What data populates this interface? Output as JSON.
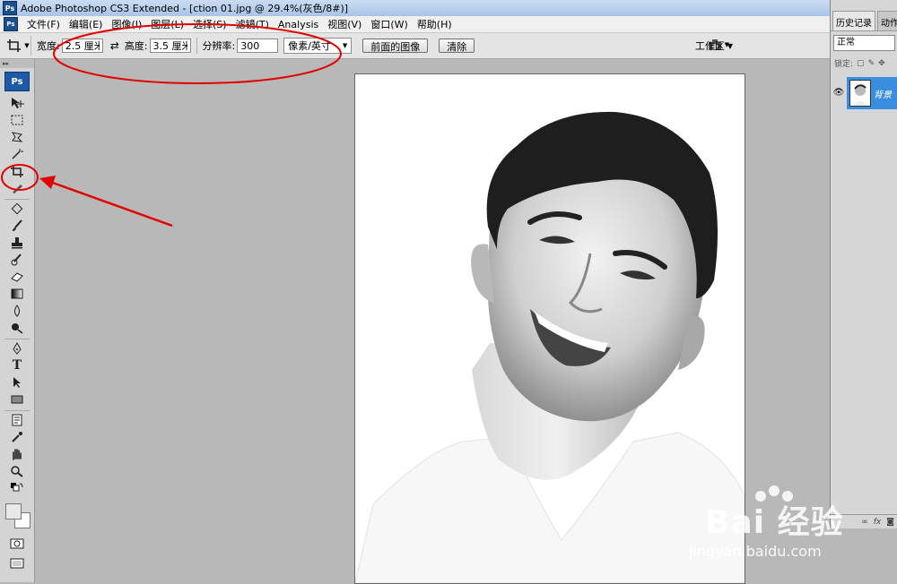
{
  "titlebar": {
    "title": "Adobe Photoshop CS3 Extended - [ction 01.jpg @ 29.4%(灰色/8#)]",
    "logo": "Ps"
  },
  "menubar": {
    "app_icon": "Ps",
    "items": [
      "文件(F)",
      "编辑(E)",
      "图像(I)",
      "图层(L)",
      "选择(S)",
      "滤镜(T)",
      "Analysis",
      "视图(V)",
      "窗口(W)",
      "帮助(H)"
    ]
  },
  "options": {
    "width_label": "宽度:",
    "width_value": "2.5 厘米",
    "height_label": "高度:",
    "height_value": "3.5 厘米",
    "resolution_label": "分辨率:",
    "resolution_value": "300",
    "unit_select": "像素/英寸",
    "front_image_button": "前面的图像",
    "clear_button": "清除",
    "workspace_label": "工作区"
  },
  "toolbox": {
    "logo": "Ps",
    "grip": "▸▸"
  },
  "panels": {
    "tabs": [
      "历史记录",
      "动作"
    ],
    "blend_mode": "正常",
    "lock_label": "锁定:",
    "layer_name": "背景"
  },
  "watermark": {
    "brand": "Bai  经验",
    "url": "jingyan.baidu.com"
  },
  "colors": {
    "annotation": "#e00000",
    "selected_layer": "#3a8ee0"
  }
}
